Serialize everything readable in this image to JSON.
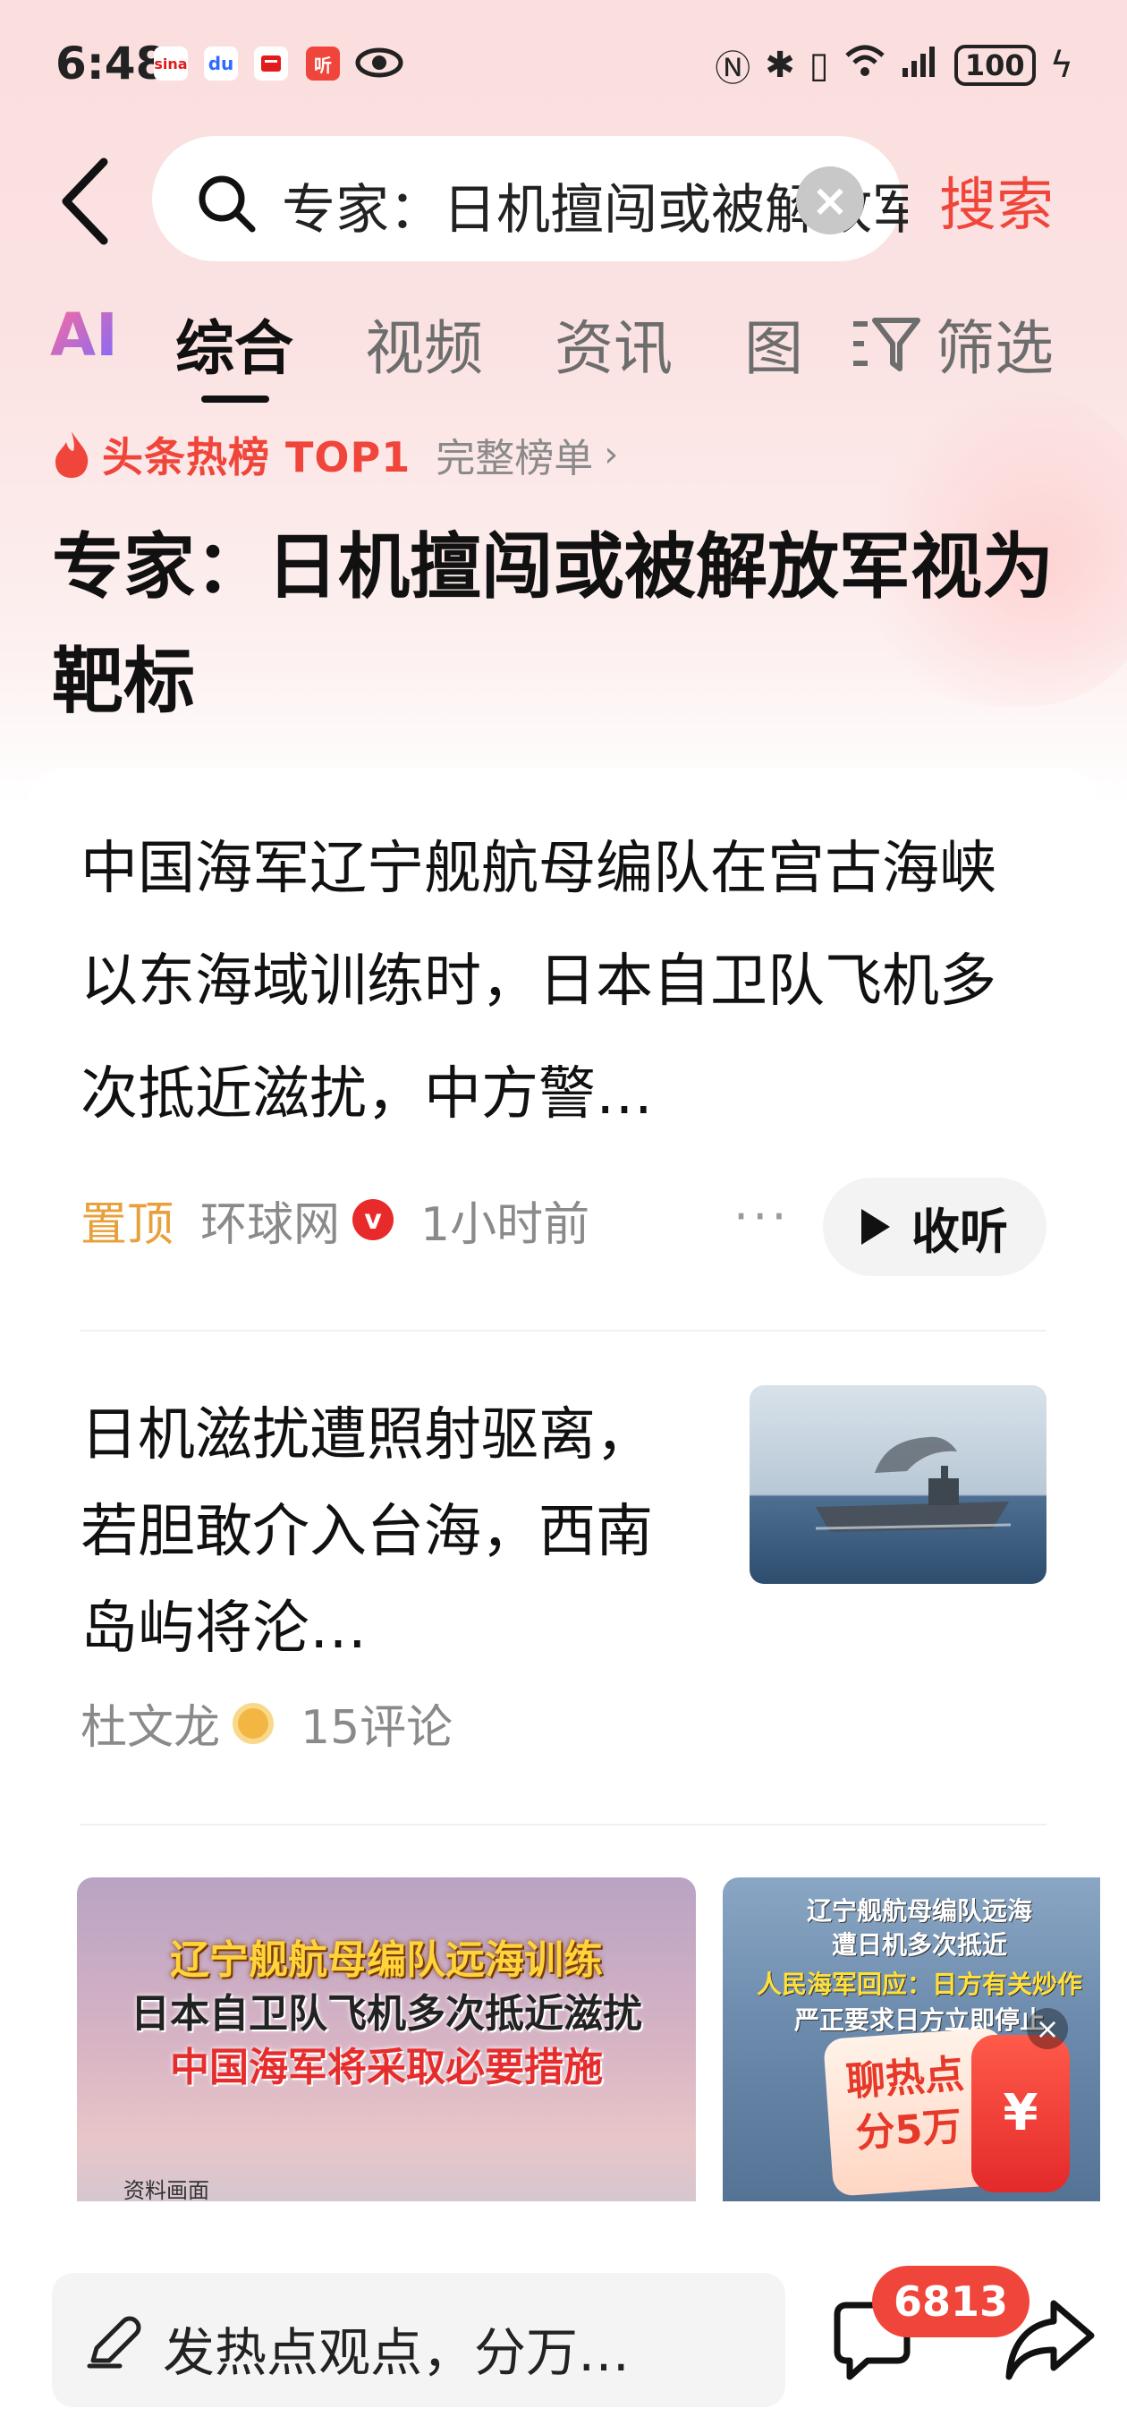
{
  "status_bar": {
    "time": "6:48",
    "apps": [
      "sina",
      "du",
      "news",
      "听"
    ],
    "battery": "100"
  },
  "search": {
    "query": "专家：日机擅闯或被解放军视为靶标",
    "action_label": "搜索"
  },
  "tabs": [
    {
      "label": "AI"
    },
    {
      "label": "综合",
      "active": true
    },
    {
      "label": "视频"
    },
    {
      "label": "资讯"
    },
    {
      "label": "图"
    },
    {
      "label": "筛选"
    }
  ],
  "hot_topic": {
    "label": "头条热榜 TOP1",
    "full_list": "完整榜单",
    "title": "专家：日机擅闯或被解放军视为靶标"
  },
  "articles": [
    {
      "title": "中国海军辽宁舰航母编队在宫古海峡以东海域训练时，日本自卫队飞机多次抵近滋扰，中方警…",
      "pin": "置顶",
      "source": "环球网",
      "verified_badge": "v",
      "time": "1小时前",
      "listen_label": "收听"
    },
    {
      "title": "日机滋扰遭照射驱离，若胆敢介入台海，西南岛屿将沦…",
      "author": "杜文龙",
      "comments": "15评论"
    }
  ],
  "videos": [
    {
      "line1": "辽宁舰航母编队远海训练",
      "line2": "日本自卫队飞机多次抵近滋扰",
      "line3": "中国海军将采取必要措施",
      "tag": "资料画面"
    },
    {
      "line1": "辽宁舰航母编队远海",
      "line2": "遭日机多次抵近",
      "line3": "人民海军回应：日方有关炒作",
      "line4": "严正要求日方立即停止"
    }
  ],
  "promo": {
    "line1": "聊热点",
    "line2": "分5万",
    "coin": "¥",
    "close": "×"
  },
  "bottom_bar": {
    "comment_placeholder": "发热点观点，分万…",
    "comment_count": "6813"
  },
  "colors": {
    "accent": "#f0453a",
    "pin": "#e8a03a",
    "header_bg": "#fbdede"
  }
}
